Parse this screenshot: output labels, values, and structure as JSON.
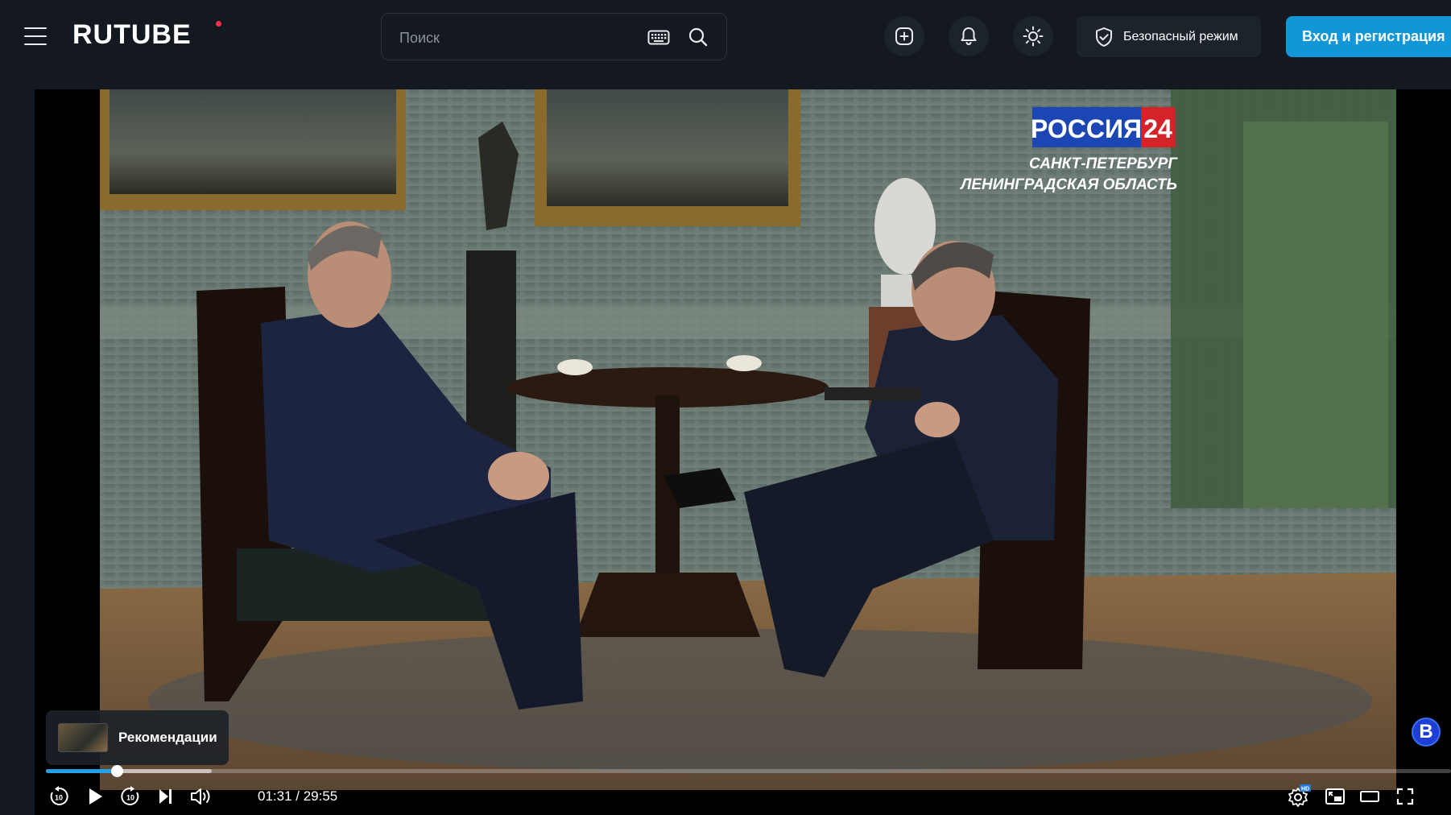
{
  "header": {
    "logo": "RUTUBE",
    "search": {
      "placeholder": "Поиск",
      "value": ""
    },
    "safe_mode_label": "Безопасный режим",
    "login_label": "Вход и регистрация"
  },
  "icons": {
    "menu": "hamburger-menu-icon",
    "keyboard": "keyboard-icon",
    "search": "search-icon",
    "upload": "add-video-icon",
    "notifications": "bell-icon",
    "theme": "sun-icon",
    "safe_mode": "shield-check-icon"
  },
  "video": {
    "channel_logo_text": "РОССИЯ",
    "channel_logo_number": "24",
    "channel_region_line1": "САНКТ-ПЕТЕРБУРГ",
    "channel_region_line2": "ЛЕНИНГРАДСКАЯ ОБЛАСТЬ"
  },
  "player": {
    "recommendations_label": "Рекомендации",
    "badge_letter": "B",
    "time_current": "01:31",
    "time_separator": " / ",
    "time_total": "29:55",
    "progress_fraction": 0.0507,
    "buffer_fraction": 0.118,
    "quality_badge": "HD"
  },
  "colors": {
    "background": "#14191f",
    "accent": "#1296d8",
    "progress": "#22a0e8",
    "logo_dot": "#ff2d4e"
  }
}
